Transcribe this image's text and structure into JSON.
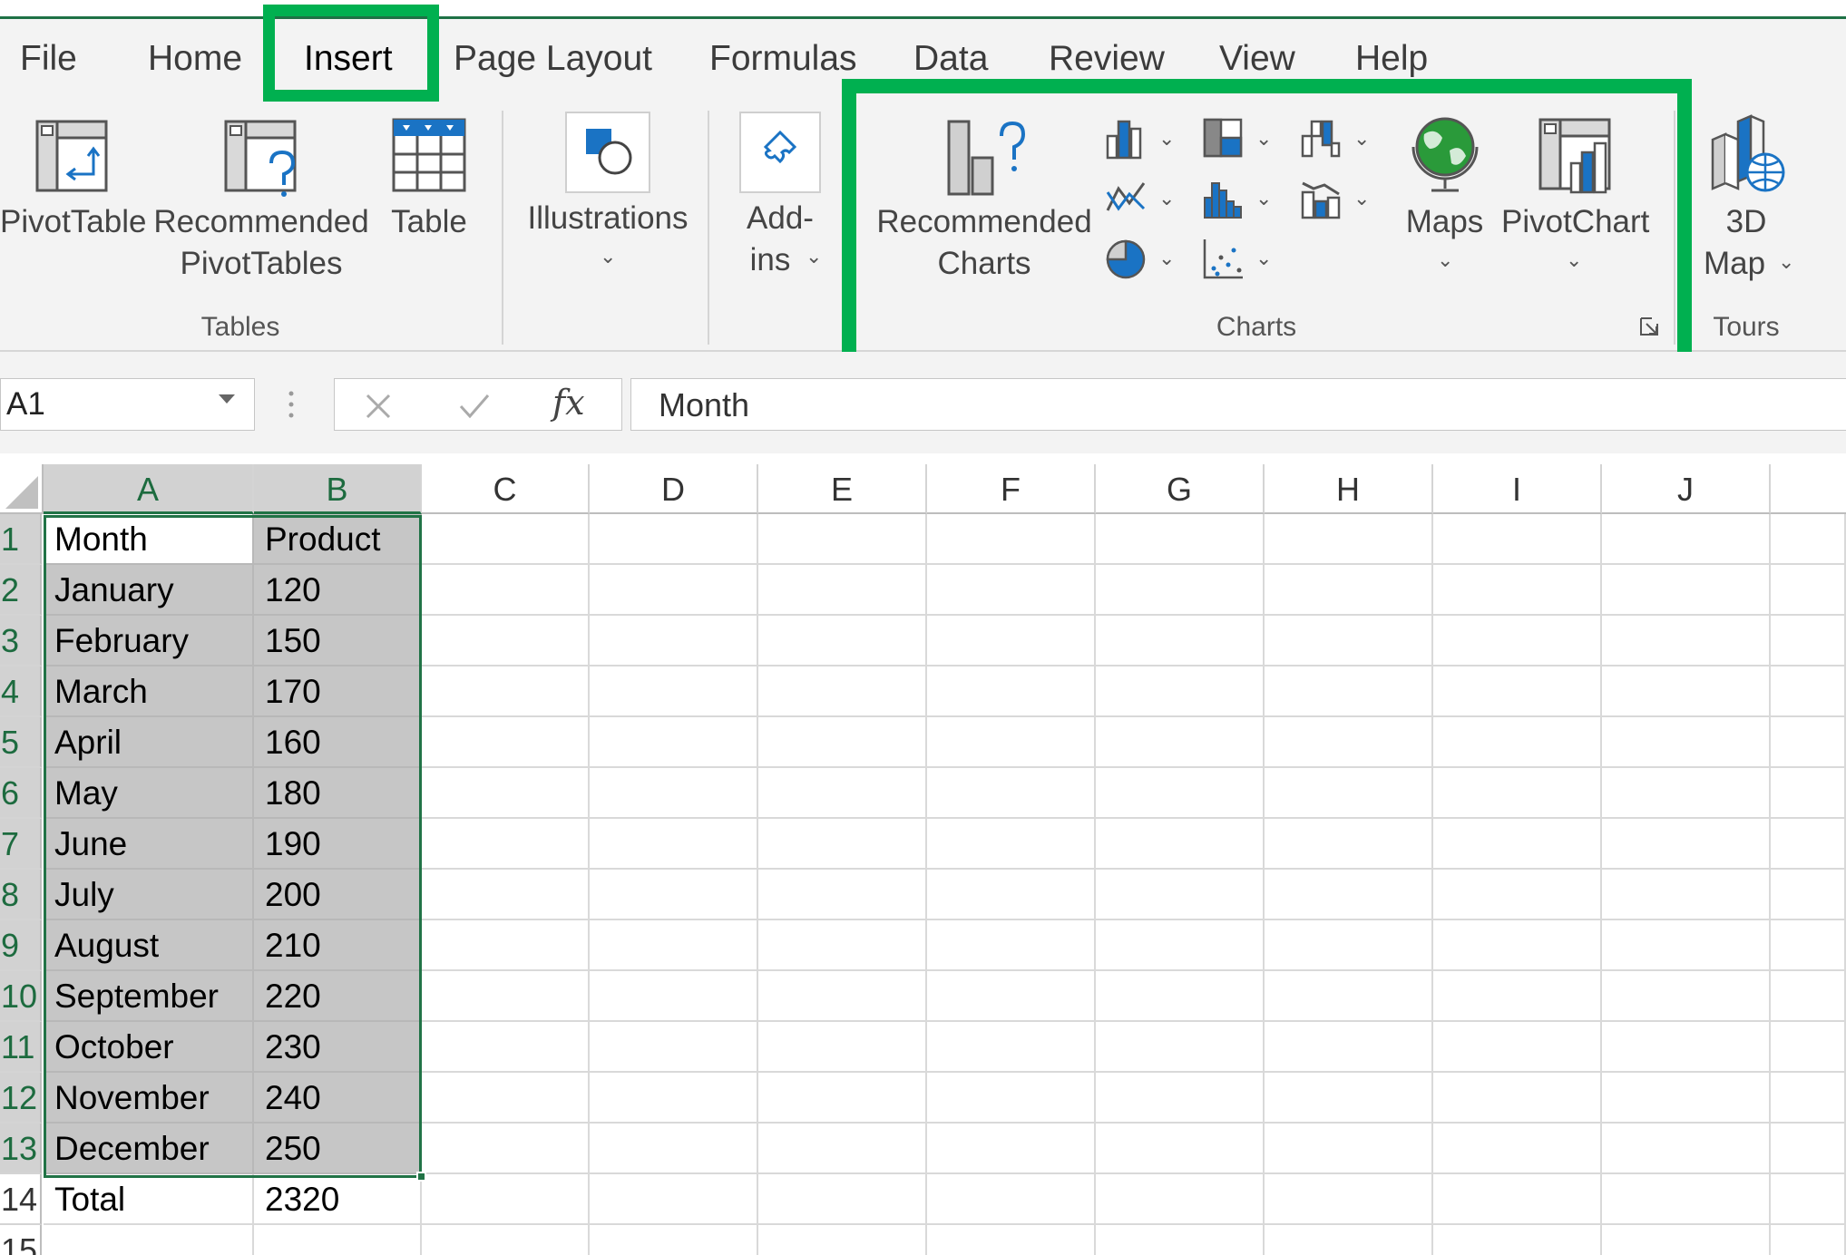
{
  "tabs": [
    "File",
    "Home",
    "Insert",
    "Page Layout",
    "Formulas",
    "Data",
    "Review",
    "View",
    "Help"
  ],
  "active_tab": "Insert",
  "ribbon": {
    "pivottable": "PivotTable",
    "recommended_pivottables": [
      "Recommended",
      "PivotTables"
    ],
    "table": "Table",
    "tables_group": "Tables",
    "illustrations": "Illustrations",
    "addins": [
      "Add-",
      "ins"
    ],
    "recommended_charts": [
      "Recommended",
      "Charts"
    ],
    "maps": "Maps",
    "pivotchart": "PivotChart",
    "charts_group": "Charts",
    "map3d": [
      "3D",
      "Map"
    ],
    "tours_group": "Tours"
  },
  "formula_bar": {
    "name_box": "A1",
    "formula": "Month",
    "fx": "fx"
  },
  "grid": {
    "columns": [
      "A",
      "B",
      "C",
      "D",
      "E",
      "F",
      "G",
      "H",
      "I",
      "J"
    ],
    "rows": [
      "1",
      "2",
      "3",
      "4",
      "5",
      "6",
      "7",
      "8",
      "9",
      "10",
      "11",
      "12",
      "13",
      "14",
      "15"
    ],
    "cells": [
      [
        "Month",
        "Product"
      ],
      [
        "January",
        "120"
      ],
      [
        "February",
        "150"
      ],
      [
        "March",
        "170"
      ],
      [
        "April",
        "160"
      ],
      [
        "May",
        "180"
      ],
      [
        "June",
        "190"
      ],
      [
        "July",
        "200"
      ],
      [
        "August",
        "210"
      ],
      [
        "September",
        "220"
      ],
      [
        "October",
        "230"
      ],
      [
        "November",
        "240"
      ],
      [
        "December",
        "250"
      ],
      [
        "Total",
        "2320"
      ]
    ],
    "selection": "A1:B13"
  },
  "colors": {
    "accent": "#217346",
    "highlight": "#00b050",
    "selection_fill": "#c6c6c6"
  }
}
